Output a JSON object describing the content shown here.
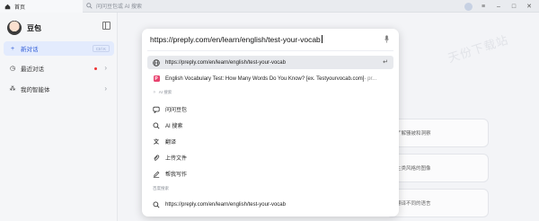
{
  "topbar": {
    "tab_label": "首页",
    "address_placeholder": "问问豆包或 AI 搜索"
  },
  "sidebar": {
    "brand": "豆包",
    "items": [
      {
        "label": "新对话",
        "shortcut": "Ctrl K",
        "active": true
      },
      {
        "label": "最近对话"
      },
      {
        "label": "我的智能体"
      }
    ]
  },
  "omnibox": {
    "input_value": "https://preply.com/en/learn/english/test-your-vocab",
    "suggestions": [
      {
        "text": "https://preply.com/en/learn/english/test-your-vocab",
        "icon": "globe-icon"
      },
      {
        "text": "English Vocabulary Test: How Many Words Do You Know? [ex. Testyourvocab.com]",
        "suffix": " - pr...",
        "icon": "preply-favicon"
      }
    ],
    "ai_section_label": "AI 搜索",
    "ai_actions": [
      {
        "label": "问问豆包",
        "icon": "chat-icon"
      },
      {
        "label": "AI 搜索",
        "icon": "search-icon"
      },
      {
        "label": "翻译",
        "icon": "translate-icon"
      },
      {
        "label": "上传文件",
        "icon": "paperclip-icon"
      },
      {
        "label": "帮我写作",
        "icon": "pen-icon"
      }
    ],
    "web_section_label": "百度搜索",
    "web_search": {
      "text": "https://preply.com/en/learn/english/test-your-vocab",
      "icon": "search-icon"
    }
  },
  "main": {
    "watermark": "天份下载站",
    "cards": [
      "了解骚被和洞察",
      "生类风格的图像",
      "翻译不同的语言"
    ]
  },
  "colors": {
    "accent": "#2e5bd8",
    "badge_dot": "#e33333"
  }
}
